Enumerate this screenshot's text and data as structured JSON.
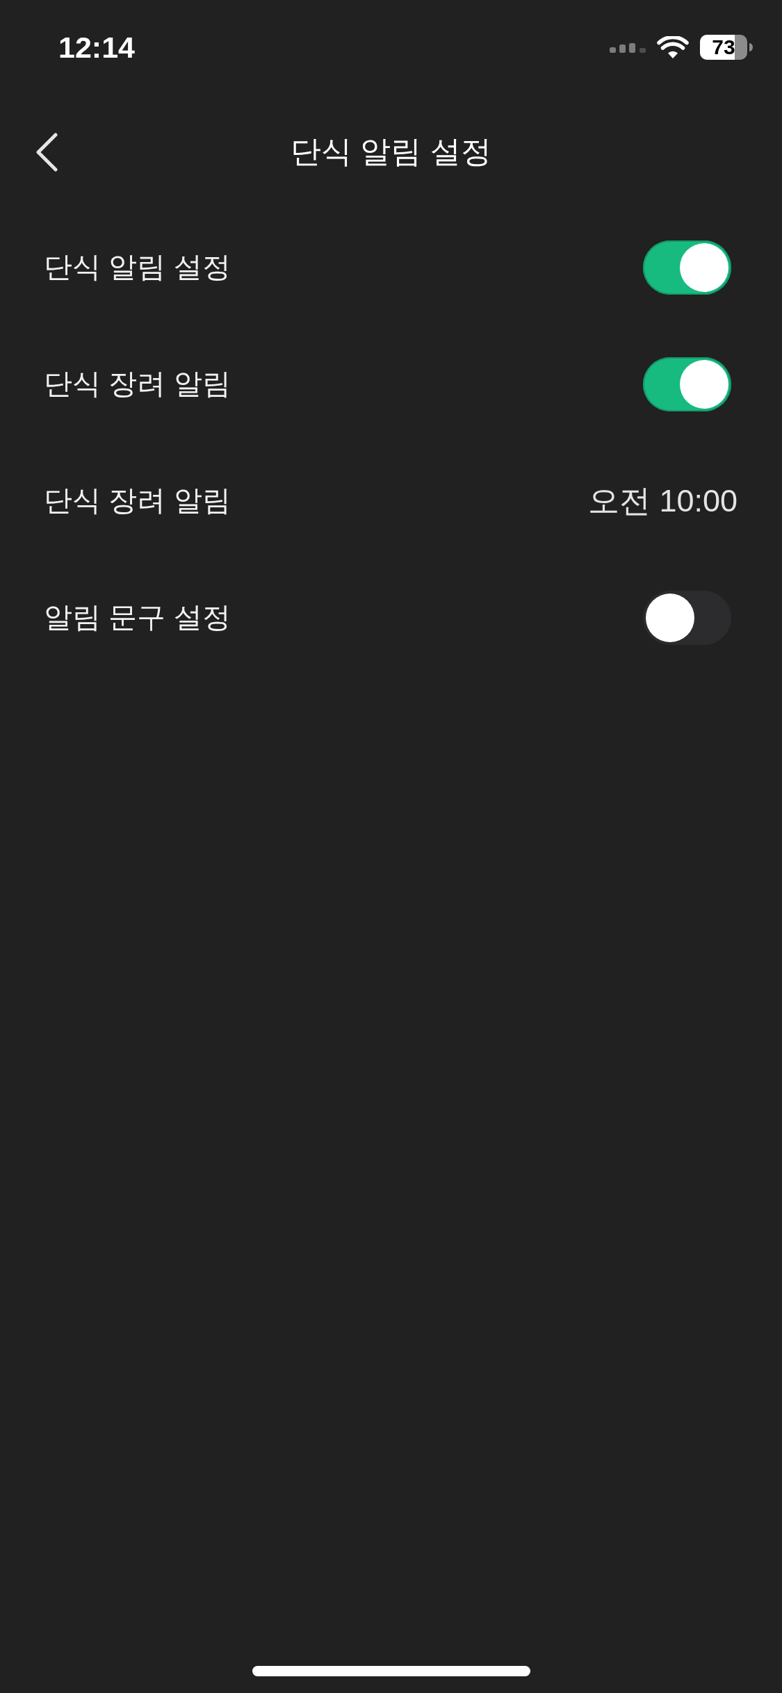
{
  "status_bar": {
    "time": "12:14",
    "battery": "73"
  },
  "nav": {
    "title": "단식 알림 설정"
  },
  "settings": [
    {
      "kind": "toggle",
      "label": "단식 알림 설정",
      "on": true
    },
    {
      "kind": "toggle",
      "label": "단식 장려 알림",
      "on": true
    },
    {
      "kind": "value",
      "label": "단식 장려 알림",
      "value": "오전 10:00"
    },
    {
      "kind": "toggle",
      "label": "알림 문구 설정",
      "on": false
    }
  ]
}
